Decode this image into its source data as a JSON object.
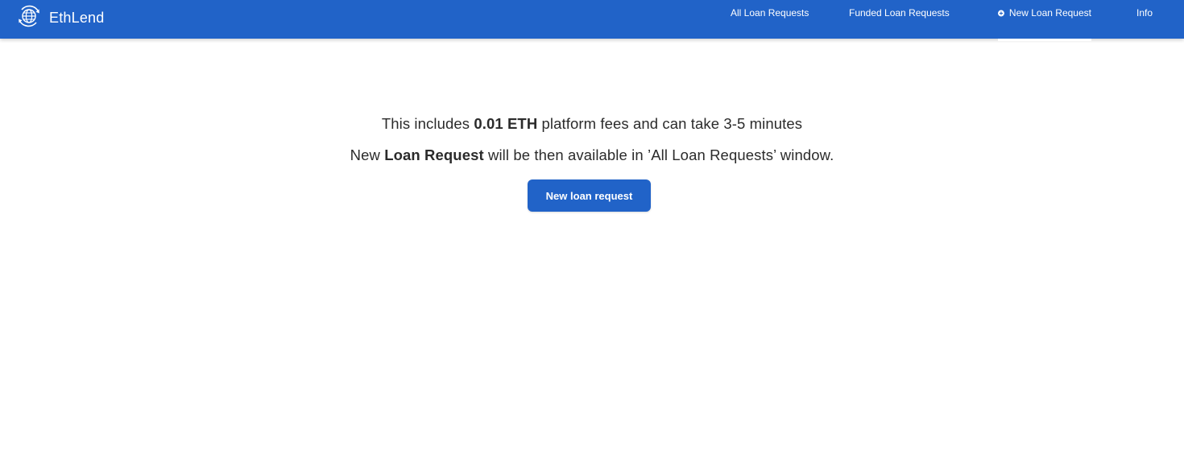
{
  "header": {
    "brand": "EthLend",
    "logo_icon": "globe-icon",
    "background": "#2163c8",
    "nav": [
      {
        "label": "All Loan Requests",
        "active": false
      },
      {
        "label": "Funded Loan Requests",
        "active": false
      },
      {
        "label": "New Loan Request",
        "active": true,
        "icon": "plus-circle-icon"
      },
      {
        "label": "Info",
        "active": false
      }
    ]
  },
  "main": {
    "line1": {
      "prefix": "This includes ",
      "bold": "0.01 ETH",
      "suffix": " platform fees and can take 3-5 minutes"
    },
    "line2": {
      "prefix": "New ",
      "bold": "Loan Request",
      "suffix": " will be then available in ’All Loan Requests’ window."
    },
    "button_label": "New loan request"
  }
}
